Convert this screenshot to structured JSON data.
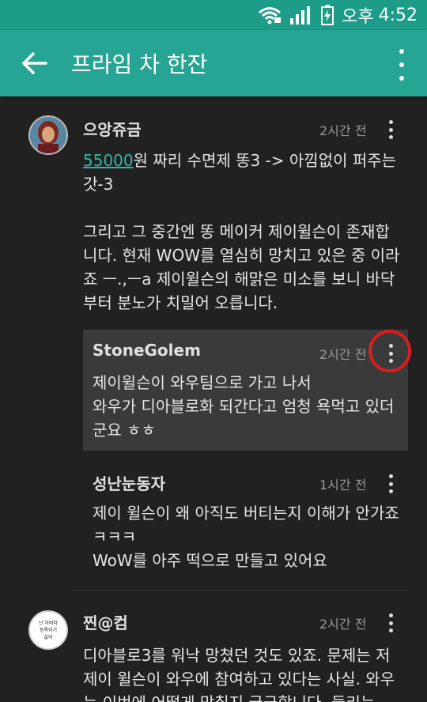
{
  "status": {
    "ampm": "오후",
    "time": "4:52"
  },
  "appbar": {
    "title": "프라임 차 한잔"
  },
  "comments": [
    {
      "name": "으앙쥬금",
      "time": "2시간 전",
      "link": "55000",
      "line1": "원 짜리 수면제 똥3 -> 아낌없이 퍼주는 갓-3",
      "para2": "그리고 그 중간엔 똥 메이커 제이윌슨이 존재합니다. 현재 WOW를 열심히 망치고 있은 중 이라죠 ㅡ.,ㅡa 제이윌슨의 해맑은 미소를 보니 바닥부터 분노가 치밀어 오릅니다."
    },
    {
      "name": "StoneGolem",
      "time": "2시간 전",
      "text": "제이윌슨이 와우팀으로 가고 나서\n와우가 디아블로화 되간다고 엄청 욕먹고 있더군요 ㅎㅎ"
    },
    {
      "name": "성난눈동자",
      "time": "1시간 전",
      "text": "제이 윌슨이 왜 아직도 버티는지 이해가 안가죠 ㅋㅋㅋ\nWoW를 아주 떡으로 만들고 있어요"
    },
    {
      "name": "찐@컴",
      "time": "2시간 전",
      "avatar_text": [
        "난 아바타",
        "등록하기",
        "싫어"
      ],
      "text": "디아블로3를 워낙 망쳤던 것도 있죠. 문제는 저 제이 윌슨이 와우에 참여하고 있다는 사실. 와우는 이번에 어떻게 망칠지 궁금합니다. 들리는"
    }
  ]
}
